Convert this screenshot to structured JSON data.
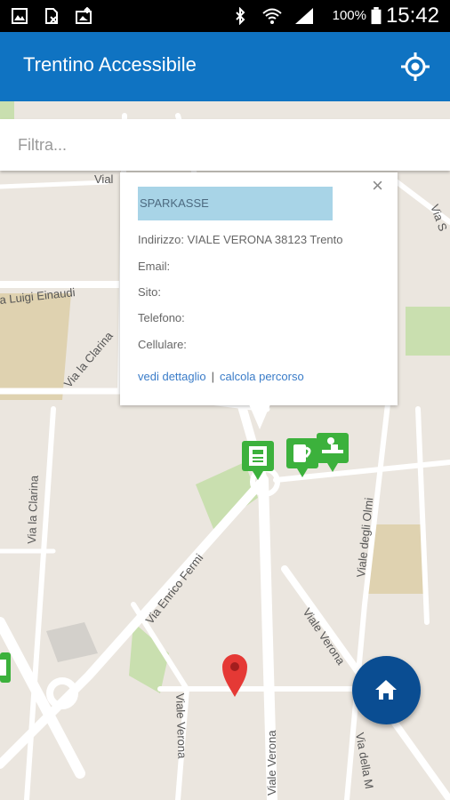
{
  "status_bar": {
    "battery_text": "100%",
    "time": "15:42"
  },
  "app_bar": {
    "title": "Trentino Accessibile",
    "locate_icon": "my-location-icon"
  },
  "filter": {
    "placeholder": "Filtra..."
  },
  "map": {
    "road_labels": [
      "Viale Verona",
      "Viale Verona",
      "Viale Verona",
      "Via Enrico Fermi",
      "Via la Clarina",
      "Via la Clarina",
      "Viale degli Olmi",
      "a Luigi Einaudi",
      "Via della M",
      "Via S",
      "Vial"
    ],
    "marker_pin_color": "#e53935",
    "poi_marker_color": "#3cb13c"
  },
  "popup": {
    "name": "SPARKASSE",
    "address": "Indirizzo: VIALE VERONA 38123 Trento",
    "email": "Email:",
    "site": "Sito:",
    "phone": "Telefono:",
    "mobile": "Cellulare:",
    "link_detail": "vedi dettaglio",
    "link_separator": "|",
    "link_route": "calcola percorso",
    "close_symbol": "×"
  },
  "fab": {
    "icon": "home-icon"
  }
}
